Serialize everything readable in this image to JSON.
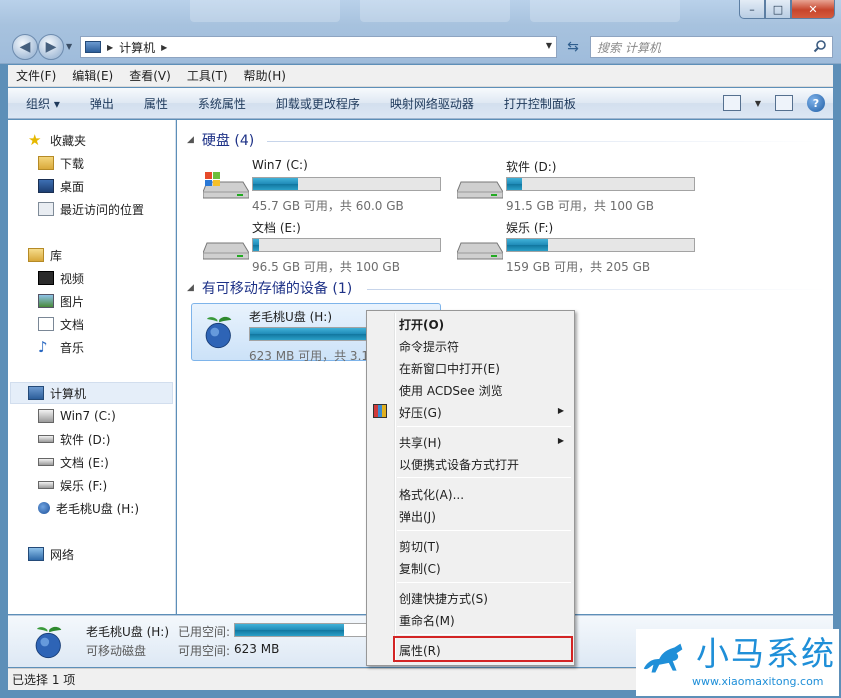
{
  "window": {
    "caption_min": "–",
    "caption_max": "□",
    "caption_close": "✕"
  },
  "address": {
    "crumb": "计算机",
    "search_placeholder": "搜索 计算机"
  },
  "menubar": [
    "文件(F)",
    "编辑(E)",
    "查看(V)",
    "工具(T)",
    "帮助(H)"
  ],
  "toolbar": [
    "组织 ▾",
    "弹出",
    "属性",
    "系统属性",
    "卸载或更改程序",
    "映射网络驱动器",
    "打开控制面板"
  ],
  "navpane": {
    "favorites": "收藏夹",
    "downloads": "下载",
    "desktop": "桌面",
    "recent": "最近访问的位置",
    "libraries": "库",
    "videos": "视频",
    "pictures": "图片",
    "documents": "文档",
    "music": "音乐",
    "computer": "计算机",
    "drive_c": "Win7 (C:)",
    "drive_d": "软件 (D:)",
    "drive_e": "文档 (E:)",
    "drive_f": "娱乐 (F:)",
    "drive_h": "老毛桃U盘 (H:)",
    "network": "网络"
  },
  "groups": {
    "hdd": "硬盘 (4)",
    "removable": "有可移动存储的设备 (1)"
  },
  "drives": [
    {
      "name": "Win7 (C:)",
      "info": "45.7 GB 可用，共 60.0 GB",
      "used_fraction": 0.24
    },
    {
      "name": "软件 (D:)",
      "info": "91.5 GB 可用，共 100 GB",
      "used_fraction": 0.08
    },
    {
      "name": "文档 (E:)",
      "info": "96.5 GB 可用，共 100 GB",
      "used_fraction": 0.03
    },
    {
      "name": "娱乐 (F:)",
      "info": "159 GB 可用，共 205 GB",
      "used_fraction": 0.22
    }
  ],
  "usb": {
    "name": "老毛桃U盘 (H:)",
    "info": "623 MB 可用，共 3.1",
    "used_fraction": 0.8
  },
  "context_menu": {
    "open": "打开(O)",
    "cmd": "命令提示符",
    "new_window": "在新窗口中打开(E)",
    "acdsee": "使用 ACDSee 浏览",
    "haozip": "好压(G)",
    "share": "共享(H)",
    "portable": "以便携式设备方式打开",
    "format": "格式化(A)...",
    "eject": "弹出(J)",
    "cut": "剪切(T)",
    "copy": "复制(C)",
    "shortcut": "创建快捷方式(S)",
    "rename": "重命名(M)",
    "properties": "属性(R)"
  },
  "details": {
    "name": "老毛桃U盘 (H:)",
    "type": "可移动磁盘",
    "used_label": "已用空间:",
    "free_label": "可用空间:",
    "free_value": "623 MB",
    "used_fraction": 0.8
  },
  "status": "已选择 1 项",
  "watermark": {
    "title": "小马系统",
    "url": "www.xiaomaxitong.com"
  },
  "colors": {
    "accent": "#1f8bb8",
    "highlight_box": "#d32424",
    "group_header": "#1e3287"
  }
}
